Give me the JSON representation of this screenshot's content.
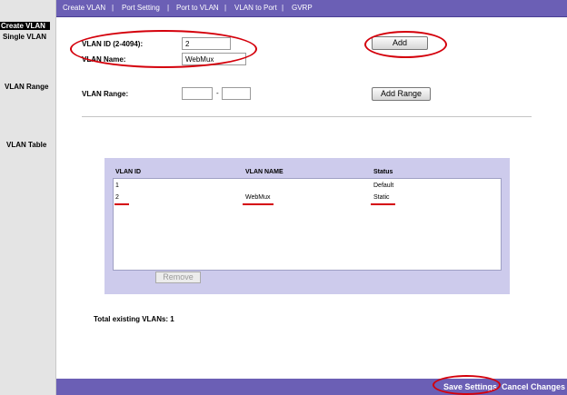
{
  "topnav": {
    "items": [
      "Create VLAN",
      "Port Setting",
      "Port to VLAN",
      "VLAN to Port",
      "GVRP"
    ],
    "separator": "|"
  },
  "sidebar": {
    "active": "Create VLAN",
    "items": [
      "Single VLAN",
      "VLAN Range",
      "VLAN Table"
    ]
  },
  "form": {
    "vlan_id_label": "VLAN ID (2-4094):",
    "vlan_id_value": "2",
    "vlan_name_label": "VLAN Name:",
    "vlan_name_value": "WebMux",
    "add_label": "Add",
    "range_label": "VLAN Range:",
    "range_dash": "-",
    "range_from": "",
    "range_to": "",
    "add_range_label": "Add Range"
  },
  "table": {
    "columns": [
      "VLAN ID",
      "VLAN NAME",
      "Status"
    ],
    "rows": [
      {
        "id": "1",
        "name": "",
        "status": "Default"
      },
      {
        "id": "2",
        "name": "WebMux",
        "status": "Static"
      }
    ],
    "remove_label": "Remove"
  },
  "total_text": "Total existing VLANs: 1",
  "bottombar": {
    "save_label": "Save Settings",
    "cancel_label": "Cancel Changes"
  },
  "colors": {
    "nav_bg": "#6b5fb5",
    "panel_bg": "#cdcbec",
    "annotation": "#d4000b"
  }
}
